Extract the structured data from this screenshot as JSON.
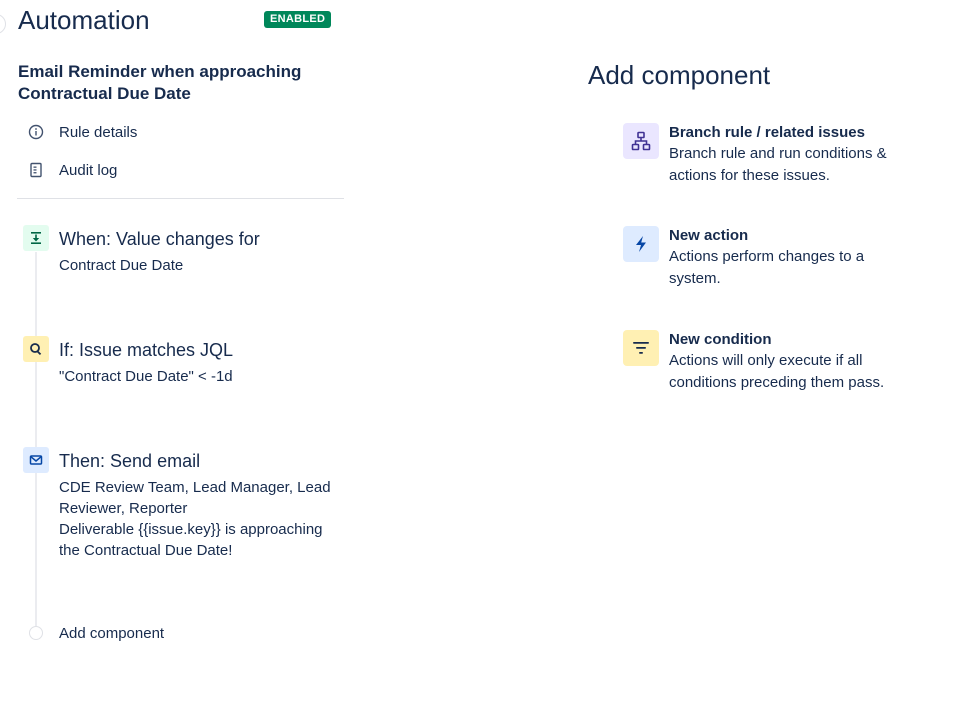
{
  "header": {
    "title": "Automation",
    "status_badge": "ENABLED"
  },
  "rule": {
    "name": "Email Reminder when approaching Contractual Due Date"
  },
  "nav": {
    "rule_details": "Rule details",
    "audit_log": "Audit log"
  },
  "steps": [
    {
      "icon": "trigger-icon",
      "title": "When: Value changes for",
      "lines": [
        "Contract Due Date"
      ],
      "color": "#E3FCEF",
      "icon_color": "#006644"
    },
    {
      "icon": "search-icon",
      "title": "If: Issue matches JQL",
      "lines": [
        "\"Contract Due Date\" < -1d"
      ],
      "color": "#FFF0B3",
      "icon_color": "#172B4D"
    },
    {
      "icon": "email-icon",
      "title": "Then: Send email",
      "lines": [
        "CDE Review Team, Lead Manager, Lead Reviewer, Reporter",
        "Deliverable {{issue.key}} is approaching the Contractual Due Date!"
      ],
      "color": "#DEEBFF",
      "icon_color": "#0747A6"
    }
  ],
  "add_component_label": "Add component",
  "panel": {
    "title": "Add component",
    "components": [
      {
        "icon": "branch-icon",
        "name": "Branch rule / related issues",
        "description": "Branch rule and run conditions & actions for these issues.",
        "color": "#EAE6FF",
        "icon_color": "#403294"
      },
      {
        "icon": "lightning-icon",
        "name": "New action",
        "description": "Actions perform changes to a system.",
        "color": "#DEEBFF",
        "icon_color": "#0747A6"
      },
      {
        "icon": "filter-icon",
        "name": "New condition",
        "description": "Actions will only execute if all conditions preceding them pass.",
        "color": "#FFF0B3",
        "icon_color": "#172B4D"
      }
    ]
  }
}
